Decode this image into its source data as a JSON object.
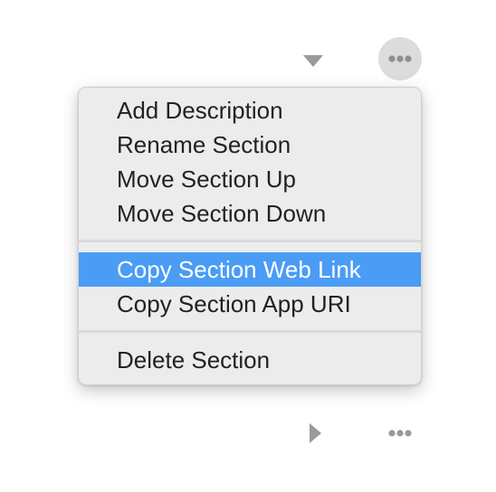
{
  "toolbar_top": {
    "collapse_icon": "chevron-down-icon",
    "more_icon": "ellipsis-icon"
  },
  "context_menu": {
    "groups": [
      [
        "Add Description",
        "Rename Section",
        "Move Section Up",
        "Move Section Down"
      ],
      [
        "Copy Section Web Link",
        "Copy Section App URI"
      ],
      [
        "Delete Section"
      ]
    ],
    "highlighted_item": "Copy Section Web Link"
  },
  "toolbar_bottom": {
    "expand_icon": "chevron-right-icon",
    "more_icon": "ellipsis-icon"
  },
  "colors": {
    "highlight": "#4a9cf5",
    "menu_background": "#ececec",
    "icon_gray": "#9a9a9a"
  }
}
